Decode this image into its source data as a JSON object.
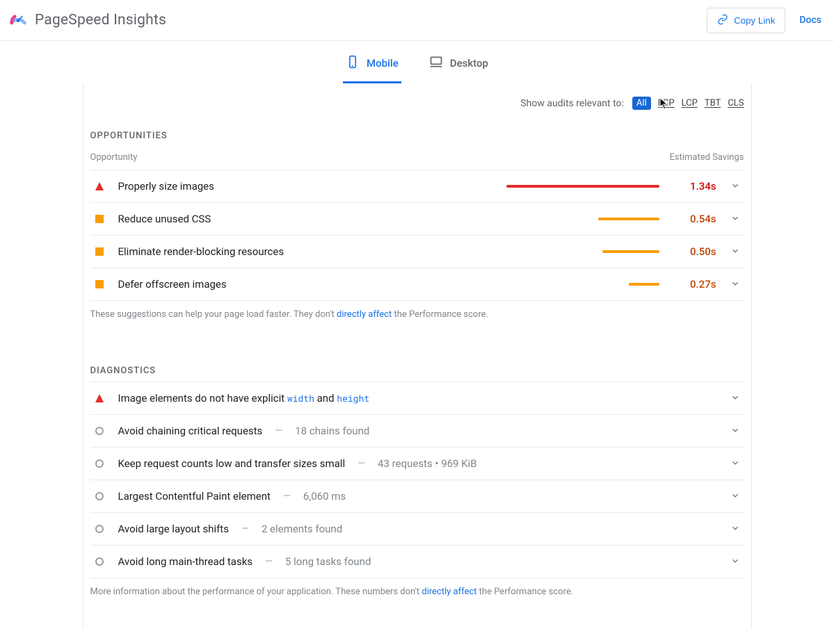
{
  "header": {
    "brand": "PageSpeed Insights",
    "copy_link": "Copy Link",
    "docs": "Docs"
  },
  "tabs": {
    "mobile": "Mobile",
    "desktop": "Desktop"
  },
  "filter": {
    "label": "Show audits relevant to:",
    "all": "All",
    "fcp": "FCP",
    "lcp": "LCP",
    "tbt": "TBT",
    "cls": "CLS"
  },
  "opportunities": {
    "heading": "OPPORTUNITIES",
    "col_left": "Opportunity",
    "col_right": "Estimated Savings",
    "rows": [
      {
        "severity": "fail",
        "title": "Properly size images",
        "value": "1.34s",
        "bar_pct": 100,
        "color": "red"
      },
      {
        "severity": "avg",
        "title": "Reduce unused CSS",
        "value": "0.54s",
        "bar_pct": 40,
        "color": "orange"
      },
      {
        "severity": "avg",
        "title": "Eliminate render-blocking resources",
        "value": "0.50s",
        "bar_pct": 37,
        "color": "orange"
      },
      {
        "severity": "avg",
        "title": "Defer offscreen images",
        "value": "0.27s",
        "bar_pct": 20,
        "color": "orange"
      }
    ],
    "footnote_pre": "These suggestions can help your page load faster. They don't ",
    "footnote_link": "directly affect",
    "footnote_post": " the Performance score."
  },
  "diagnostics": {
    "heading": "DIAGNOSTICS",
    "rows": [
      {
        "severity": "fail",
        "title_pre": "Image elements do not have explicit ",
        "code1": "width",
        "mid": " and ",
        "code2": "height",
        "extra": ""
      },
      {
        "severity": "info",
        "title": "Avoid chaining critical requests",
        "extra": "18 chains found"
      },
      {
        "severity": "info",
        "title": "Keep request counts low and transfer sizes small",
        "extra": "43 requests • 969 KiB"
      },
      {
        "severity": "info",
        "title": "Largest Contentful Paint element",
        "extra": "6,060 ms"
      },
      {
        "severity": "info",
        "title": "Avoid large layout shifts",
        "extra": "2 elements found"
      },
      {
        "severity": "info",
        "title": "Avoid long main-thread tasks",
        "extra": "5 long tasks found"
      }
    ],
    "footnote_pre": "More information about the performance of your application. These numbers don't ",
    "footnote_link": "directly affect",
    "footnote_post": " the Performance score."
  }
}
